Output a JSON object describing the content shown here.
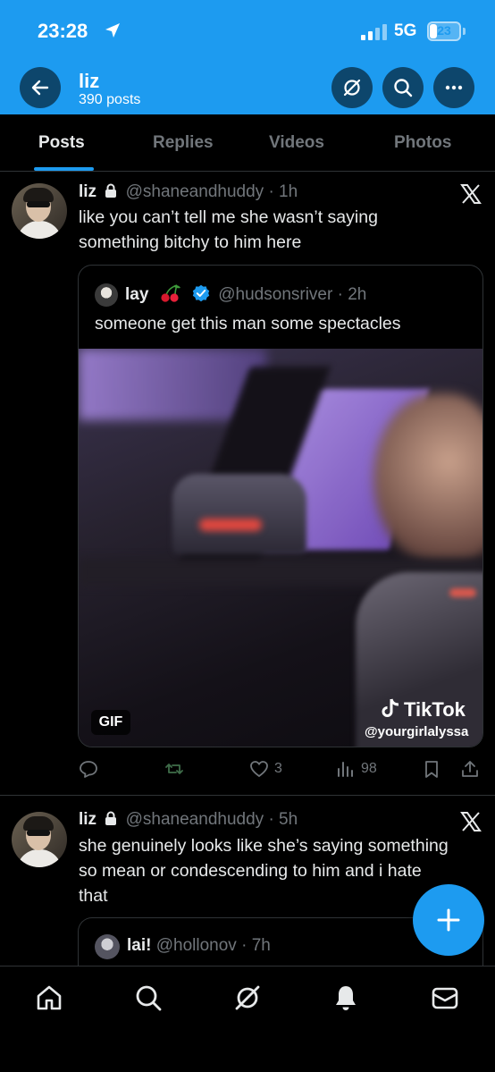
{
  "status_bar": {
    "time": "23:28",
    "network": "5G",
    "battery": "23",
    "battery_level": 0.23
  },
  "header": {
    "title": "liz",
    "subtitle": "390 posts"
  },
  "tabs": [
    "Posts",
    "Replies",
    "Videos",
    "Photos"
  ],
  "active_tab": "Posts",
  "posts": [
    {
      "name": "liz",
      "handle": "@shaneandhuddy",
      "time": "· 1h",
      "text": [
        "like you can’t tell me she wasn’t saying",
        "something bitchy to him here"
      ],
      "quote": {
        "name": "lay",
        "handle": "@hudsonsriver",
        "time": "· 2h",
        "text": "someone get this man some spectacles",
        "media_badge": "GIF",
        "watermark_brand": "TikTok",
        "watermark_user": "@yourgirlalyssa"
      },
      "stats": {
        "likes": "3",
        "views": "98"
      }
    },
    {
      "name": "liz",
      "handle": "@shaneandhuddy",
      "time": "· 5h",
      "text": [
        "she genuinely looks like she’s saying something",
        "so mean or condescending to him and i hate",
        "that"
      ],
      "quote": {
        "name": "lai!",
        "handle": "@hollonov",
        "time": "· 7h"
      }
    }
  ],
  "colors": {
    "accent": "#1d9bf0",
    "background": "#000000",
    "muted": "#71767b",
    "text": "#e7e9ea",
    "border": "#2f3336"
  },
  "icons": {
    "header": [
      "back-arrow-icon",
      "grok-icon",
      "search-icon",
      "more-icon"
    ],
    "actions": [
      "reply-icon",
      "repost-icon",
      "like-icon",
      "views-icon",
      "bookmark-icon",
      "share-icon"
    ],
    "nav": [
      "home-icon",
      "search-icon",
      "grok-icon",
      "notifications-icon",
      "messages-icon"
    ]
  }
}
